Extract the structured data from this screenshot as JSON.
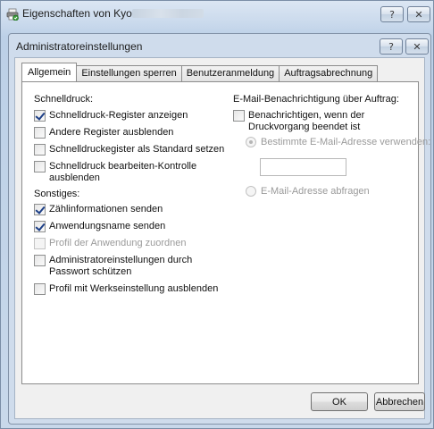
{
  "outer_window": {
    "title": "Eigenschaften von Kyocera",
    "help_glyph": "?",
    "close_glyph": "✕",
    "app_icon": "printer-properties-icon"
  },
  "dialog": {
    "title": "Administratoreinstellungen",
    "help_glyph": "?",
    "close_glyph": "✕",
    "tabs": [
      {
        "label": "Allgemein",
        "active": true
      },
      {
        "label": "Einstellungen sperren",
        "active": false
      },
      {
        "label": "Benutzeranmeldung",
        "active": false
      },
      {
        "label": "Auftragsabrechnung",
        "active": false
      }
    ],
    "schnelldruck": {
      "heading": "Schnelldruck:",
      "items": [
        {
          "label": "Schnelldruck-Register anzeigen",
          "checked": true,
          "enabled": true
        },
        {
          "label": "Andere Register ausblenden",
          "checked": false,
          "enabled": true
        },
        {
          "label": "Schnelldruckegister als Standard setzen",
          "checked": false,
          "enabled": true
        },
        {
          "label_line1": "Schnelldruck bearbeiten-Kontrolle",
          "label_line2": "ausblenden",
          "checked": false,
          "enabled": true
        }
      ]
    },
    "sonstiges": {
      "heading": "Sonstiges:",
      "items": [
        {
          "label": "Zählinformationen senden",
          "checked": true,
          "enabled": true
        },
        {
          "label": "Anwendungsname senden",
          "checked": true,
          "enabled": true
        },
        {
          "label": "Profil der Anwendung zuordnen",
          "checked": false,
          "enabled": false
        },
        {
          "label_line1": "Administratoreinstellungen durch",
          "label_line2": "Passwort schützen",
          "checked": false,
          "enabled": true
        },
        {
          "label": "Profil mit Werkseinstellung ausblenden",
          "checked": false,
          "enabled": true
        }
      ]
    },
    "email": {
      "heading": "E-Mail-Benachrichtigung über Auftrag:",
      "notify_line1": "Benachrichtigen, wenn der",
      "notify_line2": "Druckvorgang beendet ist",
      "notify_checked": false,
      "radio_specific": "Bestimmte E-Mail-Adresse verwenden:",
      "radio_specific_selected": true,
      "address_value": "",
      "radio_ask": "E-Mail-Adresse abfragen",
      "radio_ask_selected": false
    },
    "buttons": {
      "ok": "OK",
      "cancel": "Abbrechen"
    }
  }
}
